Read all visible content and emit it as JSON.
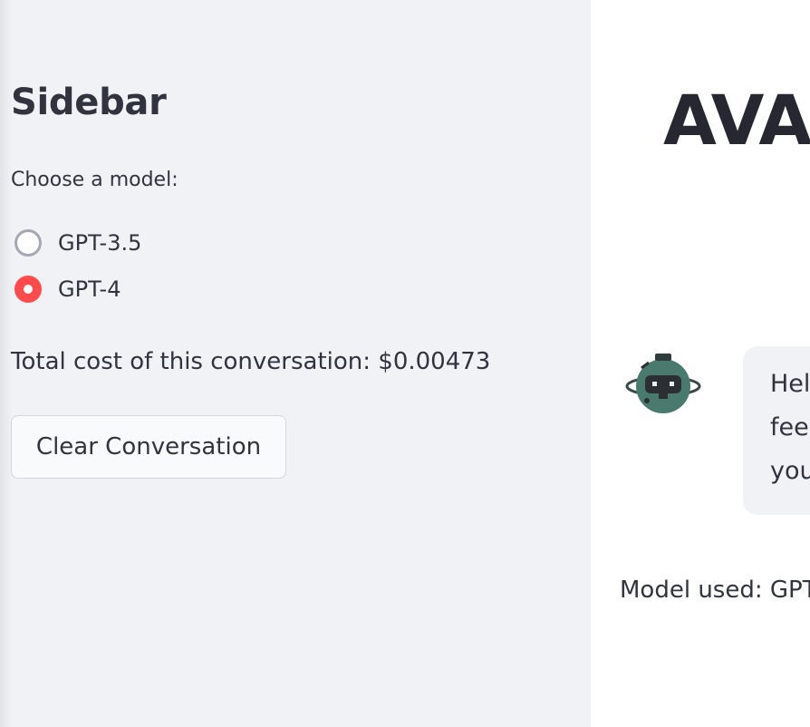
{
  "sidebar": {
    "title": "Sidebar",
    "radio_label": "Choose a model:",
    "options": [
      {
        "label": "GPT-3.5",
        "selected": false
      },
      {
        "label": "GPT-4",
        "selected": true
      }
    ],
    "cost_text": "Total cost of this conversation: $0.00473",
    "clear_button_label": "Clear Conversation"
  },
  "main": {
    "title": "AVA -",
    "message": {
      "avatar_icon": "robot-icon",
      "lines": [
        "Hel",
        "fee",
        "you"
      ]
    },
    "model_used": "Model used: GPT"
  },
  "colors": {
    "accent": "#ff4b4b",
    "sidebar_bg": "#f0f2f6",
    "text": "#31333f",
    "avatar_teal": "#4a7a6e"
  }
}
